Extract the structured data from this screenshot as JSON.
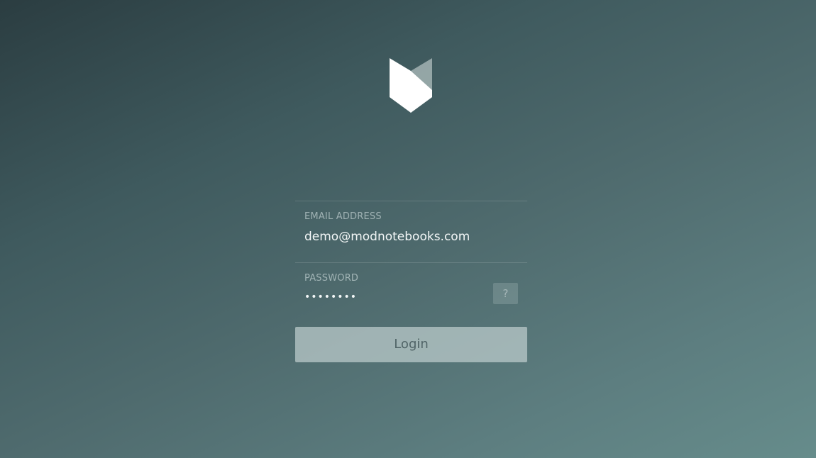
{
  "login_form": {
    "email": {
      "label": "EMAIL ADDRESS",
      "value": "demo@modnotebooks.com"
    },
    "password": {
      "label": "PASSWORD",
      "masked_value": "••••••••",
      "help_label": "?"
    },
    "login_button_label": "Login"
  },
  "logo": {
    "icon": "mod-notebooks-logo"
  },
  "colors": {
    "background_start": "#2b3d41",
    "background_end": "#668c8b",
    "button_fill": "#b4c3c3",
    "button_text": "#4f6366"
  }
}
